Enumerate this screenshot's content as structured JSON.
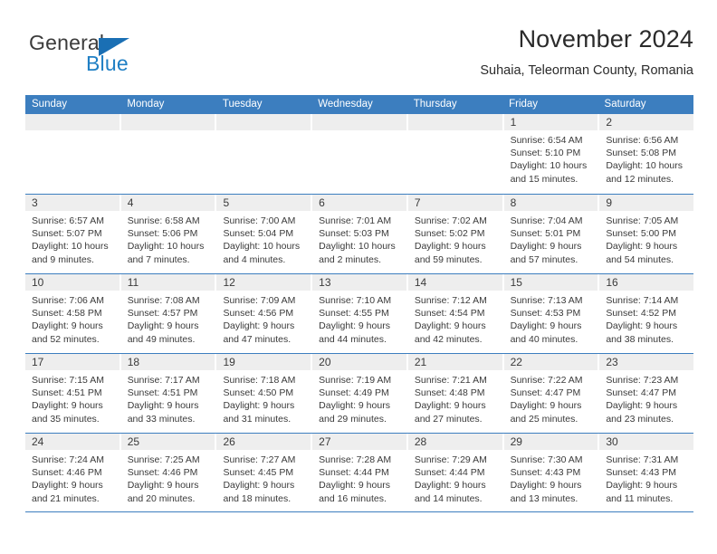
{
  "brand": {
    "name_top": "General",
    "name_bottom": "Blue",
    "logo_icon": "blue-triangle-icon"
  },
  "header": {
    "title": "November 2024",
    "subtitle": "Suhaia, Teleorman County, Romania"
  },
  "theme": {
    "accent": "#3c7ebf",
    "header_text": "#ffffff",
    "day_band": "#eeeeee",
    "text": "#3a3a3a",
    "logo_blue": "#1f7fc4"
  },
  "weekdays": [
    "Sunday",
    "Monday",
    "Tuesday",
    "Wednesday",
    "Thursday",
    "Friday",
    "Saturday"
  ],
  "weeks": [
    [
      {
        "day": "",
        "lines": []
      },
      {
        "day": "",
        "lines": []
      },
      {
        "day": "",
        "lines": []
      },
      {
        "day": "",
        "lines": []
      },
      {
        "day": "",
        "lines": []
      },
      {
        "day": "1",
        "lines": [
          "Sunrise: 6:54 AM",
          "Sunset: 5:10 PM",
          "Daylight: 10 hours",
          "and 15 minutes."
        ]
      },
      {
        "day": "2",
        "lines": [
          "Sunrise: 6:56 AM",
          "Sunset: 5:08 PM",
          "Daylight: 10 hours",
          "and 12 minutes."
        ]
      }
    ],
    [
      {
        "day": "3",
        "lines": [
          "Sunrise: 6:57 AM",
          "Sunset: 5:07 PM",
          "Daylight: 10 hours",
          "and 9 minutes."
        ]
      },
      {
        "day": "4",
        "lines": [
          "Sunrise: 6:58 AM",
          "Sunset: 5:06 PM",
          "Daylight: 10 hours",
          "and 7 minutes."
        ]
      },
      {
        "day": "5",
        "lines": [
          "Sunrise: 7:00 AM",
          "Sunset: 5:04 PM",
          "Daylight: 10 hours",
          "and 4 minutes."
        ]
      },
      {
        "day": "6",
        "lines": [
          "Sunrise: 7:01 AM",
          "Sunset: 5:03 PM",
          "Daylight: 10 hours",
          "and 2 minutes."
        ]
      },
      {
        "day": "7",
        "lines": [
          "Sunrise: 7:02 AM",
          "Sunset: 5:02 PM",
          "Daylight: 9 hours",
          "and 59 minutes."
        ]
      },
      {
        "day": "8",
        "lines": [
          "Sunrise: 7:04 AM",
          "Sunset: 5:01 PM",
          "Daylight: 9 hours",
          "and 57 minutes."
        ]
      },
      {
        "day": "9",
        "lines": [
          "Sunrise: 7:05 AM",
          "Sunset: 5:00 PM",
          "Daylight: 9 hours",
          "and 54 minutes."
        ]
      }
    ],
    [
      {
        "day": "10",
        "lines": [
          "Sunrise: 7:06 AM",
          "Sunset: 4:58 PM",
          "Daylight: 9 hours",
          "and 52 minutes."
        ]
      },
      {
        "day": "11",
        "lines": [
          "Sunrise: 7:08 AM",
          "Sunset: 4:57 PM",
          "Daylight: 9 hours",
          "and 49 minutes."
        ]
      },
      {
        "day": "12",
        "lines": [
          "Sunrise: 7:09 AM",
          "Sunset: 4:56 PM",
          "Daylight: 9 hours",
          "and 47 minutes."
        ]
      },
      {
        "day": "13",
        "lines": [
          "Sunrise: 7:10 AM",
          "Sunset: 4:55 PM",
          "Daylight: 9 hours",
          "and 44 minutes."
        ]
      },
      {
        "day": "14",
        "lines": [
          "Sunrise: 7:12 AM",
          "Sunset: 4:54 PM",
          "Daylight: 9 hours",
          "and 42 minutes."
        ]
      },
      {
        "day": "15",
        "lines": [
          "Sunrise: 7:13 AM",
          "Sunset: 4:53 PM",
          "Daylight: 9 hours",
          "and 40 minutes."
        ]
      },
      {
        "day": "16",
        "lines": [
          "Sunrise: 7:14 AM",
          "Sunset: 4:52 PM",
          "Daylight: 9 hours",
          "and 38 minutes."
        ]
      }
    ],
    [
      {
        "day": "17",
        "lines": [
          "Sunrise: 7:15 AM",
          "Sunset: 4:51 PM",
          "Daylight: 9 hours",
          "and 35 minutes."
        ]
      },
      {
        "day": "18",
        "lines": [
          "Sunrise: 7:17 AM",
          "Sunset: 4:51 PM",
          "Daylight: 9 hours",
          "and 33 minutes."
        ]
      },
      {
        "day": "19",
        "lines": [
          "Sunrise: 7:18 AM",
          "Sunset: 4:50 PM",
          "Daylight: 9 hours",
          "and 31 minutes."
        ]
      },
      {
        "day": "20",
        "lines": [
          "Sunrise: 7:19 AM",
          "Sunset: 4:49 PM",
          "Daylight: 9 hours",
          "and 29 minutes."
        ]
      },
      {
        "day": "21",
        "lines": [
          "Sunrise: 7:21 AM",
          "Sunset: 4:48 PM",
          "Daylight: 9 hours",
          "and 27 minutes."
        ]
      },
      {
        "day": "22",
        "lines": [
          "Sunrise: 7:22 AM",
          "Sunset: 4:47 PM",
          "Daylight: 9 hours",
          "and 25 minutes."
        ]
      },
      {
        "day": "23",
        "lines": [
          "Sunrise: 7:23 AM",
          "Sunset: 4:47 PM",
          "Daylight: 9 hours",
          "and 23 minutes."
        ]
      }
    ],
    [
      {
        "day": "24",
        "lines": [
          "Sunrise: 7:24 AM",
          "Sunset: 4:46 PM",
          "Daylight: 9 hours",
          "and 21 minutes."
        ]
      },
      {
        "day": "25",
        "lines": [
          "Sunrise: 7:25 AM",
          "Sunset: 4:46 PM",
          "Daylight: 9 hours",
          "and 20 minutes."
        ]
      },
      {
        "day": "26",
        "lines": [
          "Sunrise: 7:27 AM",
          "Sunset: 4:45 PM",
          "Daylight: 9 hours",
          "and 18 minutes."
        ]
      },
      {
        "day": "27",
        "lines": [
          "Sunrise: 7:28 AM",
          "Sunset: 4:44 PM",
          "Daylight: 9 hours",
          "and 16 minutes."
        ]
      },
      {
        "day": "28",
        "lines": [
          "Sunrise: 7:29 AM",
          "Sunset: 4:44 PM",
          "Daylight: 9 hours",
          "and 14 minutes."
        ]
      },
      {
        "day": "29",
        "lines": [
          "Sunrise: 7:30 AM",
          "Sunset: 4:43 PM",
          "Daylight: 9 hours",
          "and 13 minutes."
        ]
      },
      {
        "day": "30",
        "lines": [
          "Sunrise: 7:31 AM",
          "Sunset: 4:43 PM",
          "Daylight: 9 hours",
          "and 11 minutes."
        ]
      }
    ]
  ]
}
